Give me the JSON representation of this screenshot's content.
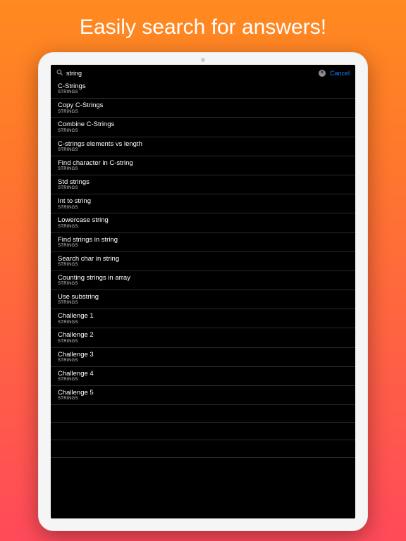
{
  "headline": "Easily search for answers!",
  "search": {
    "query": "string",
    "cancel_label": "Cancel"
  },
  "results": [
    {
      "title": "C-Strings",
      "subtitle": "STRINGS"
    },
    {
      "title": "Copy C-Strings",
      "subtitle": "STRINGS"
    },
    {
      "title": "Combine C-Strings",
      "subtitle": "STRINGS"
    },
    {
      "title": "C-strings elements vs length",
      "subtitle": "STRINGS"
    },
    {
      "title": "Find character in C-string",
      "subtitle": "STRINGS"
    },
    {
      "title": "Std strings",
      "subtitle": "STRINGS"
    },
    {
      "title": "Int to string",
      "subtitle": "STRINGS"
    },
    {
      "title": "Lowercase string",
      "subtitle": "STRINGS"
    },
    {
      "title": "Find strings in string",
      "subtitle": "STRINGS"
    },
    {
      "title": "Search char in string",
      "subtitle": "STRINGS"
    },
    {
      "title": "Counting strings in array",
      "subtitle": "STRINGS"
    },
    {
      "title": "Use substring",
      "subtitle": "STRINGS"
    },
    {
      "title": "Challenge 1",
      "subtitle": "STRINGS"
    },
    {
      "title": "Challenge 2",
      "subtitle": "STRINGS"
    },
    {
      "title": "Challenge 3",
      "subtitle": "STRINGS"
    },
    {
      "title": "Challenge 4",
      "subtitle": "STRINGS"
    },
    {
      "title": "Challenge 5",
      "subtitle": "STRINGS"
    }
  ],
  "empty_rows": 3
}
